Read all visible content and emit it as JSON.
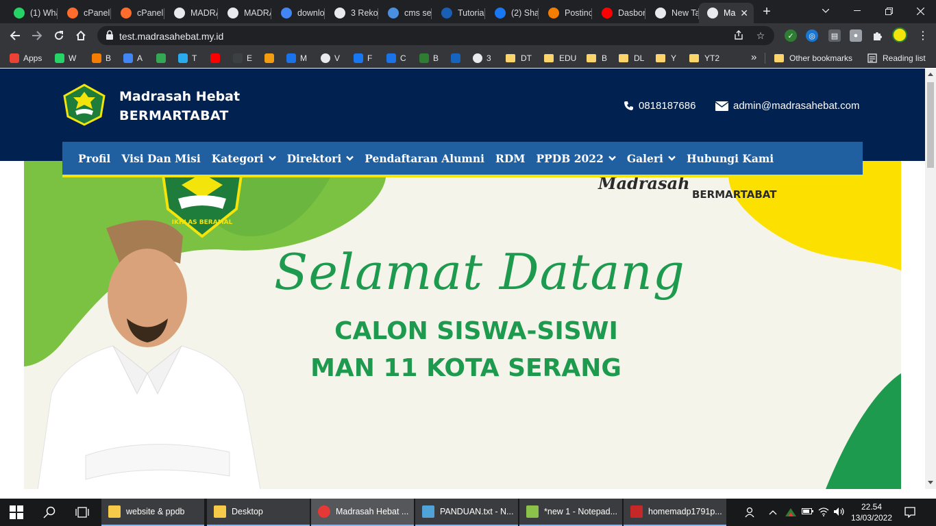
{
  "browser": {
    "tabs": [
      {
        "label": "(1) Wha",
        "icon": "whatsapp-icon",
        "color": "#25d366"
      },
      {
        "label": "cPanel",
        "icon": "cpanel-icon",
        "color": "#ff6c2c"
      },
      {
        "label": "cPanel",
        "icon": "cpanel-icon",
        "color": "#ff6c2c"
      },
      {
        "label": "MADRA",
        "icon": "globe-icon",
        "color": "#e8eaed"
      },
      {
        "label": "MADRA",
        "icon": "globe-icon",
        "color": "#e8eaed"
      },
      {
        "label": "downlo",
        "icon": "google-icon",
        "color": "#4285f4"
      },
      {
        "label": "3 Reko",
        "icon": "globe-icon",
        "color": "#e8eaed"
      },
      {
        "label": "cms se",
        "icon": "lightning-icon",
        "color": "#4a90e2"
      },
      {
        "label": "Tutoria",
        "icon": "site-icon",
        "color": "#1a5fb4"
      },
      {
        "label": "(2) Sha",
        "icon": "facebook-icon",
        "color": "#1877f2"
      },
      {
        "label": "Postinc",
        "icon": "blogger-icon",
        "color": "#f57d00"
      },
      {
        "label": "Dasbor",
        "icon": "youtube-icon",
        "color": "#ff0000"
      },
      {
        "label": "New Ta",
        "icon": "chrome-icon",
        "color": "#e8eaed"
      },
      {
        "label": "Ma",
        "icon": "globe-icon",
        "color": "#e8eaed",
        "active": true
      }
    ],
    "url": "test.madrasahebat.my.id",
    "bookmarks": [
      {
        "label": "Apps",
        "icon": "apps-icon",
        "color": "#ea4335"
      },
      {
        "label": "W",
        "icon": "whatsapp-icon",
        "color": "#25d366"
      },
      {
        "label": "B",
        "icon": "blogger-icon",
        "color": "#f57d00"
      },
      {
        "label": "A",
        "icon": "google-icon",
        "color": "#4285f4"
      },
      {
        "label": "",
        "icon": "drive-icon",
        "color": "#34a853"
      },
      {
        "label": "T",
        "icon": "telegram-icon",
        "color": "#2aabee"
      },
      {
        "label": "",
        "icon": "youtube-icon",
        "color": "#ff0000"
      },
      {
        "label": "E",
        "icon": "leaf-icon",
        "color": "#3c4043"
      },
      {
        "label": "",
        "icon": "orange-icon",
        "color": "#f39c12"
      },
      {
        "label": "M",
        "icon": "meet-icon",
        "color": "#1a73e8"
      },
      {
        "label": "V",
        "icon": "globe-icon",
        "color": "#e8eaed"
      },
      {
        "label": "F",
        "icon": "facebook-icon",
        "color": "#1877f2"
      },
      {
        "label": "C",
        "icon": "calendar-icon",
        "color": "#1a73e8"
      },
      {
        "label": "B",
        "icon": "house-icon",
        "color": "#2e7d32"
      },
      {
        "label": "",
        "icon": "kemenag-icon",
        "color": "#1565c0"
      },
      {
        "label": "3",
        "icon": "globe-icon",
        "color": "#e8eaed"
      },
      {
        "label": "DT",
        "icon": "folder-icon",
        "color": "#fbd56b"
      },
      {
        "label": "EDU",
        "icon": "folder-icon",
        "color": "#fbd56b"
      },
      {
        "label": "B",
        "icon": "folder-icon",
        "color": "#fbd56b"
      },
      {
        "label": "DL",
        "icon": "folder-icon",
        "color": "#fbd56b"
      },
      {
        "label": "Y",
        "icon": "folder-icon",
        "color": "#fbd56b"
      },
      {
        "label": "YT2",
        "icon": "folder-icon",
        "color": "#fbd56b"
      }
    ],
    "more_bookmarks": "»",
    "other_bookmarks": "Other bookmarks",
    "reading_list": "Reading list"
  },
  "site": {
    "brand_line1": "Madrasah Hebat",
    "brand_line2": "BERMARTABAT",
    "phone": "0818187686",
    "email": "admin@madrasahebat.com",
    "menu": [
      {
        "label": "Profil",
        "dropdown": false
      },
      {
        "label": "Visi Dan Misi",
        "dropdown": false
      },
      {
        "label": "Kategori",
        "dropdown": true
      },
      {
        "label": "Direktori",
        "dropdown": true
      },
      {
        "label": "Pendaftaran Alumni",
        "dropdown": false
      },
      {
        "label": "RDM",
        "dropdown": false
      },
      {
        "label": "PPDB 2022",
        "dropdown": true
      },
      {
        "label": "Galeri",
        "dropdown": true
      },
      {
        "label": "Hubungi Kami",
        "dropdown": false
      }
    ],
    "banner": {
      "tagline1": "Madrasah",
      "tagline2": "BERMARTABAT",
      "logo_motto": "IKHLAS BERAMAL",
      "heading": "Selamat Datang",
      "sub1": "CALON SISWA-SISWI",
      "sub2": "MAN 11 KOTA SERANG"
    },
    "colors": {
      "header": "#012150",
      "menu": "#2160a0",
      "accent": "#f3e50c",
      "green": "#1e9a4f"
    }
  },
  "taskbar": {
    "apps": [
      {
        "label": "website & ppdb",
        "icon": "folder-icon"
      },
      {
        "label": "Desktop",
        "icon": "folder-icon"
      },
      {
        "label": "Madrasah Hebat ...",
        "icon": "chrome-icon",
        "active": true
      },
      {
        "label": "PANDUAN.txt - N...",
        "icon": "notepad-icon"
      },
      {
        "label": "*new 1 - Notepad...",
        "icon": "notepadpp-icon"
      },
      {
        "label": "homemadp1791p...",
        "icon": "pdf-icon"
      }
    ],
    "time": "22.54",
    "date": "13/03/2022"
  }
}
